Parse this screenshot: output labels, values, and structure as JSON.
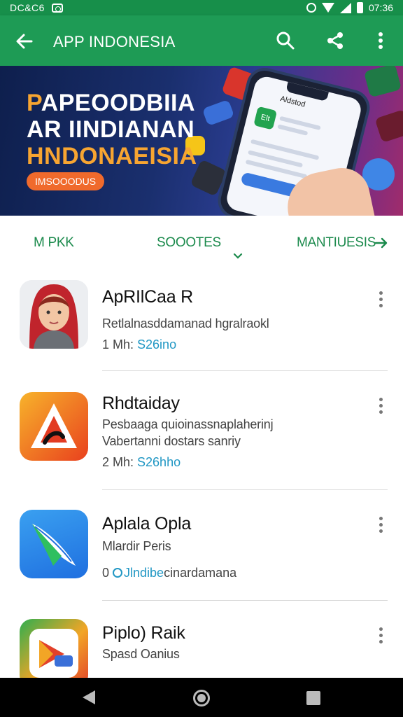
{
  "status_bar": {
    "left_text": "DC&C6",
    "time": "07:36"
  },
  "app_bar": {
    "title": "APP INDONESIA"
  },
  "banner": {
    "line1_first": "P",
    "line1_rest": "APEOODBIIA",
    "line2": "AR IINDIANAN",
    "line3": "HNDONAEISIA",
    "cta": "IMSOOODUS",
    "phone_title": "Aldstod",
    "phone_app": "Elt"
  },
  "tabs": [
    {
      "label": "M PKK"
    },
    {
      "label": "SOOOTES"
    },
    {
      "label": "MANTIUESIS"
    }
  ],
  "apps": [
    {
      "name": "ApRIlCaa R",
      "line1": "Retlalnasddamanad hgralraokl",
      "line2": "",
      "meta_prefix": "1 Mh: ",
      "meta_accent": "S26ino",
      "meta_suffix": ""
    },
    {
      "name": "Rhdtaiday",
      "line1": "Pesbaaga quioinassnaplaherinj",
      "line2": "Vabertanni dostars sanriy",
      "meta_prefix": "2 Mh: ",
      "meta_accent": "S26hho",
      "meta_suffix": ""
    },
    {
      "name": "Aplala Opla",
      "line1": "Mlardir Peris",
      "line2": "",
      "meta_prefix": "0 ",
      "meta_accent": "Jlndibe",
      "meta_suffix": "cinardamana"
    },
    {
      "name": "Piplo) Raik",
      "line1": "Spasd Oanius",
      "line2": "",
      "meta_prefix": "",
      "meta_accent": "",
      "meta_suffix": ""
    }
  ],
  "colors": {
    "primary": "#1e9b55",
    "status": "#178f4a",
    "tab_text": "#1b8a4c",
    "accent": "#2197c4",
    "banner_orange": "#f7a531"
  },
  "icons": [
    "back-arrow-icon",
    "search-icon",
    "share-icon",
    "more-vert-icon",
    "chevron-down-icon",
    "arrow-right-icon"
  ]
}
